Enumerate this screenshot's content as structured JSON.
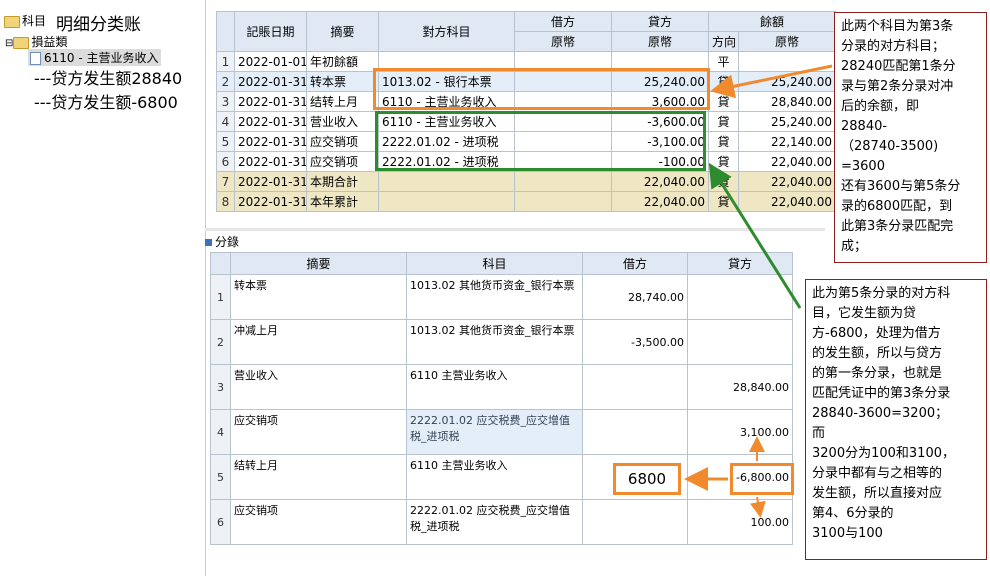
{
  "tree": {
    "root": "科目",
    "title": "明细分类账",
    "group": "損益類",
    "item": "6110 - 主营业务收入",
    "note1": "---贷方发生额28840",
    "note2": "---贷方发生额-6800"
  },
  "ledger": {
    "headers": {
      "date": "記賬日期",
      "summary": "摘要",
      "counter": "對方科目",
      "debit": "借方",
      "credit": "貸方",
      "balance": "餘額",
      "orig": "原幣",
      "dir": "方向"
    },
    "rows": [
      {
        "n": "1",
        "date": "2022-01-01",
        "summary": "年初餘額",
        "counter": "",
        "debit": "",
        "credit": "",
        "dir": "平",
        "bal": ""
      },
      {
        "n": "2",
        "date": "2022-01-31",
        "summary": "转本票",
        "counter": "1013.02 - 银行本票",
        "debit": "",
        "credit": "25,240.00",
        "dir": "貸",
        "bal": "25,240.00"
      },
      {
        "n": "3",
        "date": "2022-01-31",
        "summary": "结转上月",
        "counter": "6110 - 主营业务收入",
        "debit": "",
        "credit": "3,600.00",
        "dir": "貸",
        "bal": "28,840.00"
      },
      {
        "n": "4",
        "date": "2022-01-31",
        "summary": "营业收入",
        "counter": "6110 - 主营业务收入",
        "debit": "",
        "credit": "-3,600.00",
        "dir": "貸",
        "bal": "25,240.00"
      },
      {
        "n": "5",
        "date": "2022-01-31",
        "summary": "应交销项",
        "counter": "2222.01.02 - 进项税",
        "debit": "",
        "credit": "-3,100.00",
        "dir": "貸",
        "bal": "22,140.00"
      },
      {
        "n": "6",
        "date": "2022-01-31",
        "summary": "应交销项",
        "counter": "2222.01.02 - 进项税",
        "debit": "",
        "credit": "-100.00",
        "dir": "貸",
        "bal": "22,040.00"
      },
      {
        "n": "7",
        "date": "2022-01-31",
        "summary": "本期合計",
        "counter": "",
        "debit": "",
        "credit": "22,040.00",
        "dir": "貸",
        "bal": "22,040.00"
      },
      {
        "n": "8",
        "date": "2022-01-31",
        "summary": "本年累計",
        "counter": "",
        "debit": "",
        "credit": "22,040.00",
        "dir": "貸",
        "bal": "22,040.00"
      }
    ]
  },
  "entries": {
    "title": "分錄",
    "headers": {
      "summary": "摘要",
      "account": "科目",
      "debit": "借方",
      "credit": "貸方"
    },
    "rows": [
      {
        "n": "1",
        "summary": "转本票",
        "account": "1013.02 其他货币资金_银行本票",
        "debit": "28,740.00",
        "credit": ""
      },
      {
        "n": "2",
        "summary": "冲减上月",
        "account": "1013.02 其他货币资金_银行本票",
        "debit": "-3,500.00",
        "credit": ""
      },
      {
        "n": "3",
        "summary": "营业收入",
        "account": "6110 主营业务收入",
        "debit": "",
        "credit": "28,840.00"
      },
      {
        "n": "4",
        "summary": "应交销项",
        "account": "2222.01.02 应交税费_应交增值税_进项税",
        "debit": "",
        "credit": "3,100.00"
      },
      {
        "n": "5",
        "summary": "结转上月",
        "account": "6110 主营业务收入",
        "debit": "",
        "credit": "-6,800.00"
      },
      {
        "n": "6",
        "summary": "应交销项",
        "account": "2222.01.02 应交税费_应交增值税_进项税",
        "debit": "",
        "credit": "100.00"
      }
    ]
  },
  "callout": {
    "value": "6800"
  },
  "note_top": [
    "此两个科目为第3条",
    "分录的对方科目；",
    "28240匹配第1条分",
    "录与第2条分录对冲",
    "后的余额，即",
    "28840-",
    "（28740-3500)",
    "=3600",
    "还有3600与第5条分",
    "录的6800匹配，到",
    "此第3条分录匹配完",
    "成；"
  ],
  "note_bottom": [
    "此为第5条分录的对方科",
    "目，它发生额为贷",
    "方-6800，处理为借方",
    "的发生额，所以与贷方",
    "的第一条分录，也就是",
    "匹配凭证中的第3条分录",
    "28840-3600=3200；",
    "而",
    "3200分为100和3100，",
    "分录中都有与之相等的",
    "发生额，所以直接对应",
    "第4、6分录的",
    "3100与100"
  ],
  "colors": {
    "orange": "#f08a2c",
    "green": "#2e8b2e",
    "note_border": "#8a1e1e",
    "header": "#dfe8f3",
    "sum": "#efe6c4"
  }
}
